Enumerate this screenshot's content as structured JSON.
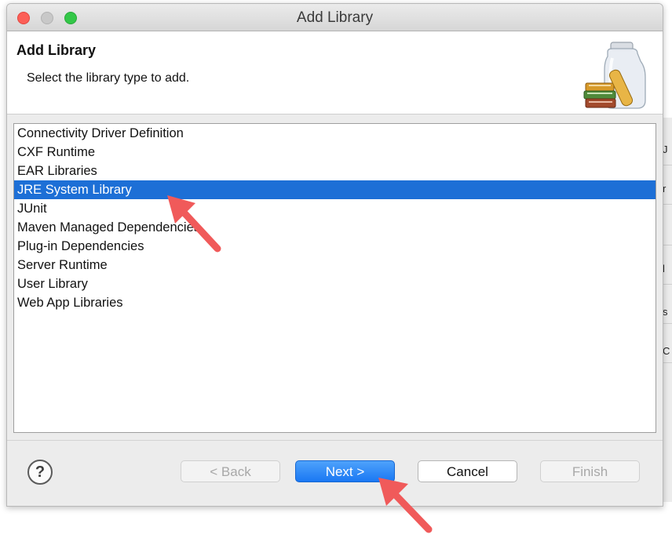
{
  "window": {
    "title": "Add Library"
  },
  "banner": {
    "title": "Add Library",
    "description": "Select the library type to add."
  },
  "library_types": [
    {
      "label": "Connectivity Driver Definition",
      "selected": false
    },
    {
      "label": "CXF Runtime",
      "selected": false
    },
    {
      "label": "EAR Libraries",
      "selected": false
    },
    {
      "label": "JRE System Library",
      "selected": true
    },
    {
      "label": "JUnit",
      "selected": false
    },
    {
      "label": "Maven Managed Dependencies",
      "selected": false
    },
    {
      "label": "Plug-in Dependencies",
      "selected": false
    },
    {
      "label": "Server Runtime",
      "selected": false
    },
    {
      "label": "User Library",
      "selected": false
    },
    {
      "label": "Web App Libraries",
      "selected": false
    }
  ],
  "buttons": {
    "help": "?",
    "back": "< Back",
    "next": "Next >",
    "cancel": "Cancel",
    "finish": "Finish"
  },
  "background_window": {
    "glyphs": [
      "J",
      "r",
      "l",
      "s",
      "C"
    ]
  },
  "colors": {
    "selection": "#1d6fd6",
    "primary_button": "#1a78f3",
    "annotation_arrow": "#f05a5a",
    "close": "#fc5f57",
    "maximize": "#33c748"
  },
  "icons": [
    "close-traffic-light",
    "minimize-traffic-light",
    "maximize-traffic-light",
    "library-jar-icon",
    "help-icon",
    "annotation-arrow"
  ]
}
